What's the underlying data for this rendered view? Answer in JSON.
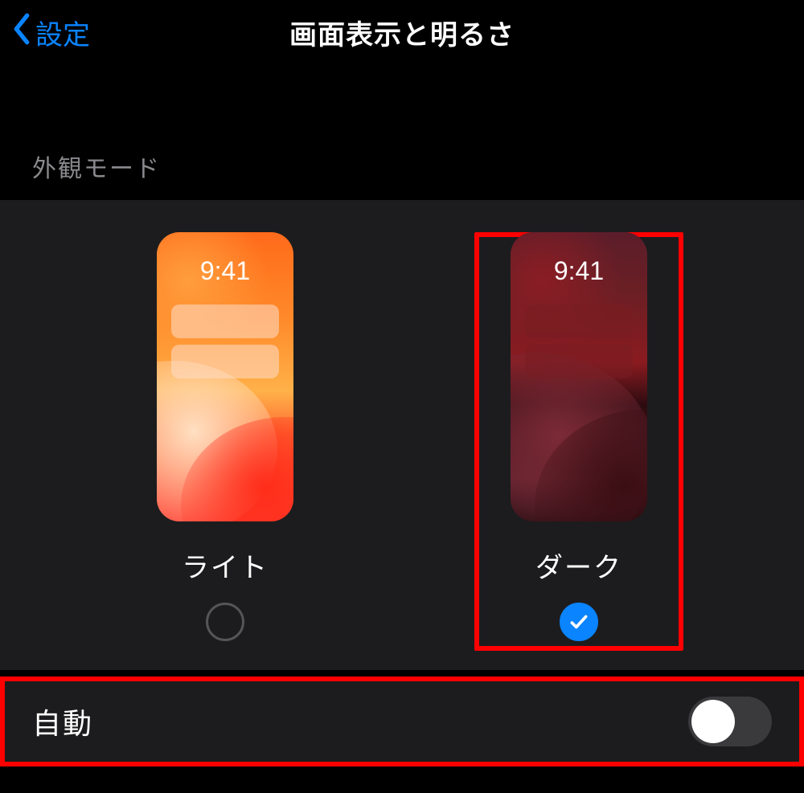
{
  "nav": {
    "back_label": "設定",
    "title": "画面表示と明るさ"
  },
  "appearance": {
    "section_header": "外観モード",
    "preview_time": "9:41",
    "options": [
      {
        "label": "ライト",
        "selected": false
      },
      {
        "label": "ダーク",
        "selected": true
      }
    ]
  },
  "automatic": {
    "label": "自動",
    "enabled": false
  },
  "colors": {
    "accent": "#0a84ff",
    "highlight": "#ff0000"
  }
}
